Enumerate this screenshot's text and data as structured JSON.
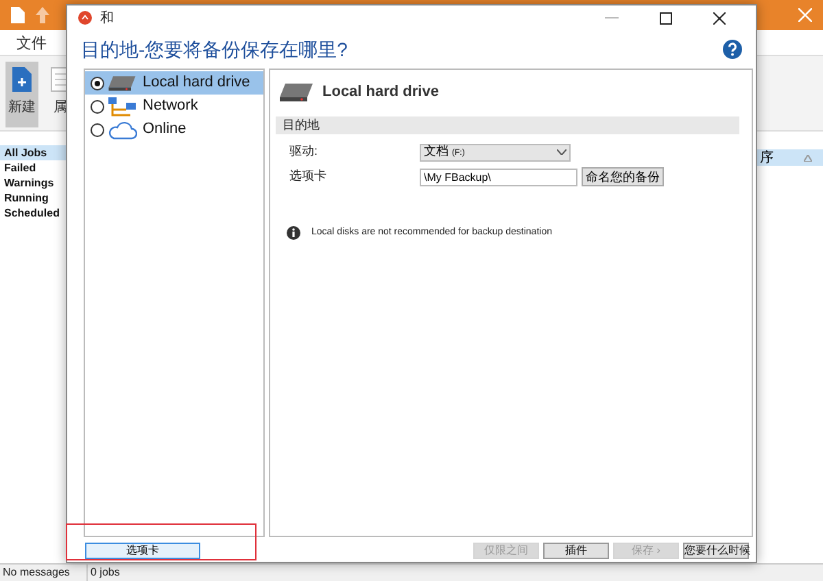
{
  "app": {
    "ribbon_tabs": [
      {
        "label": "文件",
        "selected": false
      }
    ],
    "ribbon_buttons": [
      {
        "label": "新建",
        "selected": true,
        "kind": "new"
      },
      {
        "label": "属",
        "selected": false,
        "kind": "props"
      }
    ],
    "job_filters": [
      {
        "label": "All Jobs",
        "selected": true
      },
      {
        "label": "Failed",
        "selected": false
      },
      {
        "label": "Warnings",
        "selected": false
      },
      {
        "label": "Running",
        "selected": false
      },
      {
        "label": "Scheduled",
        "selected": false
      }
    ],
    "column_header": "序",
    "status_bar": [
      "No messages",
      "0 jobs"
    ]
  },
  "dialog": {
    "title": "和",
    "heading": "目的地-您要将备份保存在哪里?",
    "destinations": [
      {
        "label": "Local hard drive",
        "selected": true,
        "kind": "drive"
      },
      {
        "label": "Network",
        "selected": false,
        "kind": "network"
      },
      {
        "label": "Online",
        "selected": false,
        "kind": "cloud"
      }
    ],
    "panel_title": "Local hard drive",
    "section": "目的地",
    "drive_label": "驱动:",
    "drive_value": "文档",
    "drive_value_suffix": "(F:)",
    "path_label": "选项卡",
    "path_value": "\\My FBackup\\",
    "rename_button": "命名您的备份",
    "info": "Local disks are not recommended for backup destination",
    "options_button": "选项卡",
    "buttons": [
      {
        "label": "仅限之间",
        "disabled": true
      },
      {
        "label": "插件",
        "disabled": false
      },
      {
        "label": "保存 ›",
        "disabled": true
      },
      {
        "label": "您要什么时候",
        "disabled": false
      }
    ]
  }
}
